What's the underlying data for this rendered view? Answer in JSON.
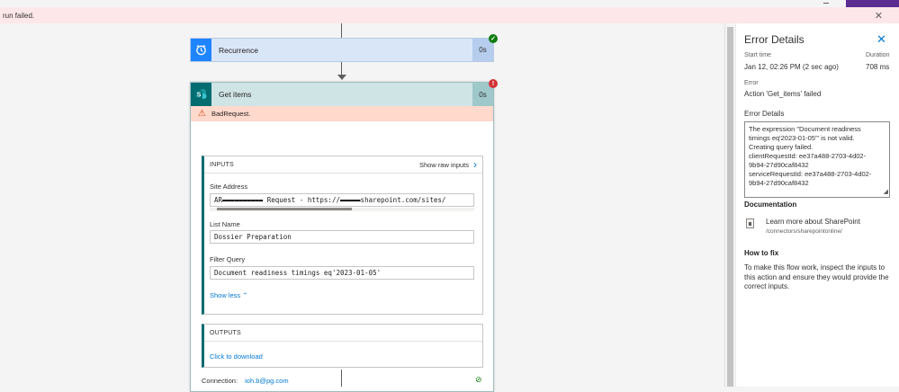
{
  "banner": {
    "message": "run failed.",
    "close_glyph": "✕"
  },
  "flow": {
    "recurrence": {
      "title": "Recurrence",
      "duration": "0s",
      "status_glyph": "✓",
      "icon": "alarm-clock-icon",
      "color": "#1f85ff"
    },
    "get_items": {
      "title": "Get items",
      "duration": "0s",
      "status_glyph": "!",
      "icon": "sharepoint-icon",
      "icon_letter": "S",
      "color": "#036c70",
      "error_label": "BadRequest.",
      "inputs": {
        "heading": "INPUTS",
        "show_raw": "Show raw inputs",
        "site_address_label": "Site Address",
        "site_address_value": "AR▬▬▬▬▬▬▬▬▬▬ Request - https://▬▬▬▬▬sharepoint.com/sites/",
        "list_name_label": "List Name",
        "list_name_value": "Dossier Preparation",
        "filter_query_label": "Filter Query",
        "filter_query_value": "Document readiness timings eq'2023-01-05'",
        "show_less": "Show less"
      },
      "outputs": {
        "heading": "OUTPUTS",
        "download": "Click to download"
      },
      "connection_label": "Connection:",
      "connection_account": "ioh.b@pg.com"
    }
  },
  "panel": {
    "title": "Error Details",
    "start_time_label": "Start time",
    "start_time_value": "Jan 12, 02:26 PM (2 sec ago)",
    "duration_label": "Duration",
    "duration_value": "708 ms",
    "error_label": "Error",
    "error_value": "Action 'Get_items' failed",
    "error_details_heading": "Error Details",
    "error_details_lines": [
      "The expression \"Document readiness",
      "timings eq'2023-01-05'\" is not valid.",
      "Creating query failed.",
      "clientRequestId: ee37a488-2703-4d02-",
      "9b94-27d90caf8432",
      "serviceRequestId: ee37a488-2703-4d02-",
      "9b94-27d90caf8432"
    ],
    "documentation_heading": "Documentation",
    "doc_link": "Learn more about SharePoint",
    "doc_path": "/connectors/sharepointonline/",
    "how_to_fix_heading": "How to fix",
    "how_to_fix_text": "To make this flow work, inspect the inputs to this action and ensure they would provide the correct inputs."
  },
  "colors": {
    "error_banner": "#fde7e9",
    "success": "#107c10",
    "failure": "#d13438",
    "link": "#0078d4"
  }
}
